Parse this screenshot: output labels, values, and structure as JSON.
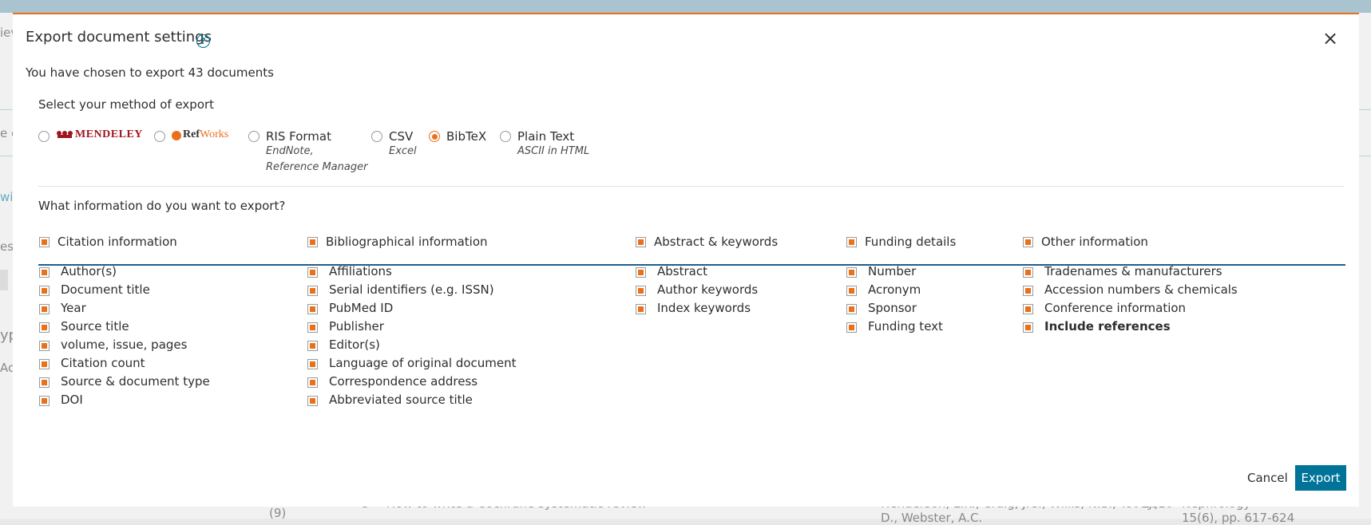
{
  "background": {
    "fragments": [
      "iev",
      "e e",
      "wi",
      "es",
      "yp",
      "Ac",
      "(9)",
      "3",
      "How to write a Cochrane systematic review",
      "Henderson, L.K., Craig, J.C., Willis, N.S., Tovey,",
      "2010",
      "Nephrology",
      "D., Webster, A.C.",
      "15(6), pp. 617-624"
    ]
  },
  "modal": {
    "title": "Export document settings",
    "help_icon": "?",
    "close_icon": "×",
    "subtitle": "You have chosen to export 43 documents",
    "method_label": "Select your method of export",
    "methods": [
      {
        "label": "MENDELEY",
        "sub": [],
        "checked": false
      },
      {
        "label_ref": "Ref",
        "label_works": "Works",
        "sub": [],
        "checked": false
      },
      {
        "label": "RIS Format",
        "sub": [
          "EndNote,",
          "Reference Manager"
        ],
        "checked": false
      },
      {
        "label": "CSV",
        "sub": [
          "Excel"
        ],
        "checked": false
      },
      {
        "label": "BibTeX",
        "sub": [],
        "checked": true
      },
      {
        "label": "Plain Text",
        "sub": [
          "ASCII in HTML"
        ],
        "checked": false
      }
    ],
    "info_label": "What information do you want to export?",
    "groups": [
      {
        "header": "Citation information",
        "items": [
          "Author(s)",
          "Document title",
          "Year",
          "Source title",
          "volume, issue, pages",
          "Citation count",
          "Source & document type",
          "DOI"
        ]
      },
      {
        "header": "Bibliographical information",
        "items": [
          "Affiliations",
          "Serial identifiers (e.g. ISSN)",
          "PubMed ID",
          "Publisher",
          "Editor(s)",
          "Language of original document",
          "Correspondence address",
          "Abbreviated source title"
        ]
      },
      {
        "header": "Abstract & keywords",
        "items": [
          "Abstract",
          "Author keywords",
          "Index keywords"
        ]
      },
      {
        "header": "Funding details",
        "items": [
          "Number",
          "Acronym",
          "Sponsor",
          "Funding text"
        ]
      },
      {
        "header": "Other information",
        "items": [
          "Tradenames & manufacturers",
          "Accession numbers & chemicals",
          "Conference information",
          "Include references"
        ]
      }
    ],
    "cancel_label": "Cancel",
    "export_label": "Export",
    "accent_color": "#e9711c",
    "primary_color": "#007398"
  }
}
